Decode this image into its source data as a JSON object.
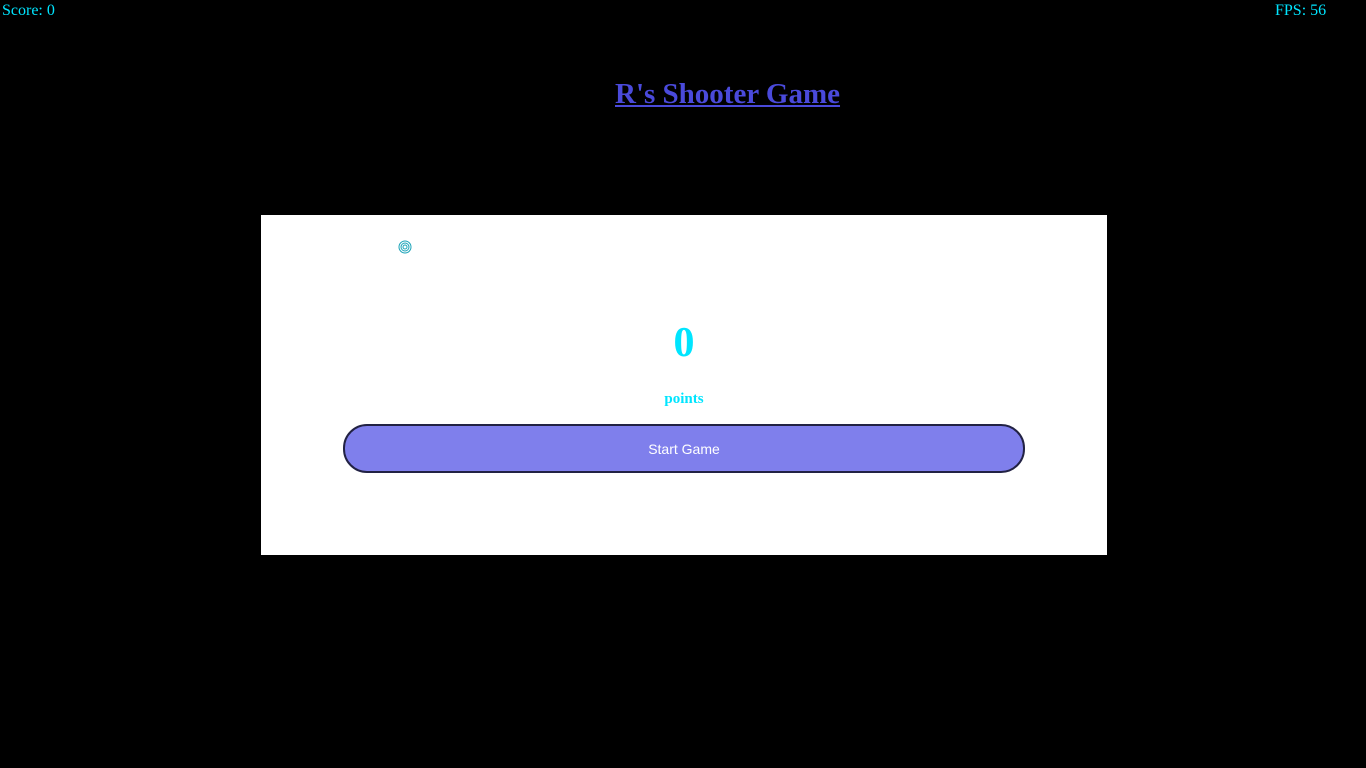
{
  "hud": {
    "score_text": "Score: 0",
    "fps_text": "FPS: 56"
  },
  "title": "R's Shooter Game",
  "menu": {
    "score_value": "0",
    "points_label": "points",
    "start_button_label": "Start Game"
  },
  "icons": {
    "player": "target-rings-icon"
  },
  "colors": {
    "background": "#000000",
    "hud_text": "#00e5ff",
    "title": "#4a4adb",
    "panel": "#ffffff",
    "button": "#7f7fec",
    "button_text": "#ffffff"
  }
}
